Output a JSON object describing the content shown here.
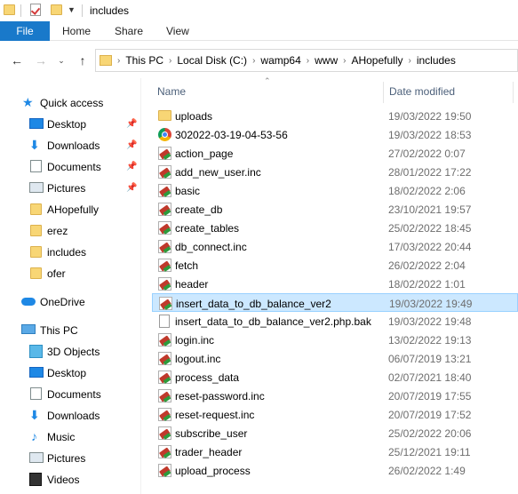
{
  "window": {
    "title": "includes"
  },
  "ribbon": {
    "tabs": [
      "File",
      "Home",
      "Share",
      "View"
    ]
  },
  "address": {
    "crumbs": [
      "This PC",
      "Local Disk (C:)",
      "wamp64",
      "www",
      "AHopefully",
      "includes"
    ]
  },
  "columns": {
    "name": "Name",
    "date": "Date modified"
  },
  "sidebar": {
    "quick_access": "Quick access",
    "items": [
      {
        "label": "Desktop",
        "icon": "desktop-icon",
        "pinned": true
      },
      {
        "label": "Downloads",
        "icon": "download-icon",
        "pinned": true
      },
      {
        "label": "Documents",
        "icon": "documents-icon",
        "pinned": true
      },
      {
        "label": "Pictures",
        "icon": "pictures-icon",
        "pinned": true
      },
      {
        "label": "AHopefully",
        "icon": "folder-icon",
        "pinned": false
      },
      {
        "label": "erez",
        "icon": "folder-icon",
        "pinned": false
      },
      {
        "label": "includes",
        "icon": "folder-icon",
        "pinned": false
      },
      {
        "label": "ofer",
        "icon": "folder-icon",
        "pinned": false
      }
    ],
    "onedrive": "OneDrive",
    "this_pc": "This PC",
    "pc_items": [
      {
        "label": "3D Objects",
        "icon": "3d-objects-icon"
      },
      {
        "label": "Desktop",
        "icon": "desktop-icon"
      },
      {
        "label": "Documents",
        "icon": "documents-icon"
      },
      {
        "label": "Downloads",
        "icon": "download-icon"
      },
      {
        "label": "Music",
        "icon": "music-icon"
      },
      {
        "label": "Pictures",
        "icon": "pictures-icon"
      },
      {
        "label": "Videos",
        "icon": "videos-icon"
      }
    ]
  },
  "files": [
    {
      "name": "uploads",
      "date": "19/03/2022 19:50",
      "type": "folder",
      "selected": false
    },
    {
      "name": "302022-03-19-04-53-56",
      "date": "19/03/2022 18:53",
      "type": "chrome",
      "selected": false
    },
    {
      "name": "action_page",
      "date": "27/02/2022 0:07",
      "type": "php",
      "selected": false
    },
    {
      "name": "add_new_user.inc",
      "date": "28/01/2022 17:22",
      "type": "php",
      "selected": false
    },
    {
      "name": "basic",
      "date": "18/02/2022 2:06",
      "type": "php",
      "selected": false
    },
    {
      "name": "create_db",
      "date": "23/10/2021 19:57",
      "type": "php",
      "selected": false
    },
    {
      "name": "create_tables",
      "date": "25/02/2022 18:45",
      "type": "php",
      "selected": false
    },
    {
      "name": "db_connect.inc",
      "date": "17/03/2022 20:44",
      "type": "php",
      "selected": false
    },
    {
      "name": "fetch",
      "date": "26/02/2022 2:04",
      "type": "php",
      "selected": false
    },
    {
      "name": "header",
      "date": "18/02/2022 1:01",
      "type": "php",
      "selected": false
    },
    {
      "name": "insert_data_to_db_balance_ver2",
      "date": "19/03/2022 19:49",
      "type": "php",
      "selected": true
    },
    {
      "name": "insert_data_to_db_balance_ver2.php.bak",
      "date": "19/03/2022 19:48",
      "type": "doc",
      "selected": false
    },
    {
      "name": "login.inc",
      "date": "13/02/2022 19:13",
      "type": "php",
      "selected": false
    },
    {
      "name": "logout.inc",
      "date": "06/07/2019 13:21",
      "type": "php",
      "selected": false
    },
    {
      "name": "process_data",
      "date": "02/07/2021 18:40",
      "type": "php",
      "selected": false
    },
    {
      "name": "reset-password.inc",
      "date": "20/07/2019 17:55",
      "type": "php",
      "selected": false
    },
    {
      "name": "reset-request.inc",
      "date": "20/07/2019 17:52",
      "type": "php",
      "selected": false
    },
    {
      "name": "subscribe_user",
      "date": "25/02/2022 20:06",
      "type": "php",
      "selected": false
    },
    {
      "name": "trader_header",
      "date": "25/12/2021 19:11",
      "type": "php",
      "selected": false
    },
    {
      "name": "upload_process",
      "date": "26/02/2022 1:49",
      "type": "php",
      "selected": false
    }
  ],
  "colors": {
    "accent": "#1979ca",
    "selection": "#cce8ff",
    "selection_border": "#99d1ff",
    "header_text": "#4c607a",
    "date_text": "#6d6d6d"
  }
}
